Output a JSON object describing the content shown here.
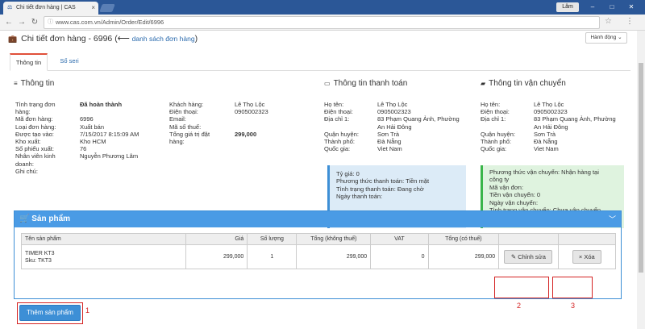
{
  "browser": {
    "tab_title": "Chi tiết đơn hàng | CAS ",
    "tab_close": "×",
    "user": "Lâm",
    "url": "www.cas.com.vn/Admin/Order/Edit/6996",
    "win_min": "–",
    "win_max": "□",
    "win_close": "✕"
  },
  "page": {
    "title": "Chi tiết đơn hàng - 6996",
    "back_arrow": " (⟵ ",
    "back_link": "danh sách đơn hàng",
    "back_close": ")",
    "action_button": "Hành động ⌄",
    "tabs": [
      "Thông tin",
      "Sổ seri"
    ]
  },
  "info": {
    "heading": "Thông tin",
    "col1": [
      {
        "k": "Tình trạng đơn",
        "v": "Đã hoàn thành"
      },
      {
        "k": "hàng:",
        "v": ""
      },
      {
        "k": "Mã đơn hàng:",
        "v": "6996"
      },
      {
        "k": "Loại đơn hàng:",
        "v": "Xuất bán"
      },
      {
        "k": "Được tạo vào:",
        "v": "7/15/2017 8:15:09 AM"
      },
      {
        "k": "Kho xuất:",
        "v": "Kho HCM"
      },
      {
        "k": "Số phiếu xuất:",
        "v": "76"
      },
      {
        "k": "Nhân viên kinh",
        "v": "Nguyễn Phương Lâm"
      },
      {
        "k": "doanh:",
        "v": ""
      },
      {
        "k": "Ghi chú:",
        "v": ""
      }
    ],
    "col2": [
      {
        "k": "Khách hàng:",
        "v": "Lê Thọ Lộc"
      },
      {
        "k": "Điện thoại:",
        "v": "0905002323"
      },
      {
        "k": "Email:",
        "v": ""
      },
      {
        "k": "Mã số thuế:",
        "v": ""
      },
      {
        "k": "Tổng giá trị đặt",
        "v": "299,000"
      },
      {
        "k": "hàng:",
        "v": ""
      }
    ]
  },
  "payment": {
    "heading": "Thông tin thanh toán",
    "rows": [
      {
        "k": "Họ tên:",
        "v": "Lê Thọ Lộc"
      },
      {
        "k": "Điện thoại:",
        "v": "0905002323"
      },
      {
        "k": "Địa chỉ 1:",
        "v": "83 Phạm Quang Ảnh, Phường"
      },
      {
        "k": "",
        "v": "An Hải Đông"
      },
      {
        "k": "Quận huyện:",
        "v": "Sơn Trà"
      },
      {
        "k": "Thành phố:",
        "v": "Đà Nẵng"
      },
      {
        "k": "Quốc gia:",
        "v": "Viet Nam"
      }
    ],
    "box": [
      "Tỷ giá: 0",
      "Phương thức thanh toán: Tiền mặt",
      "Tình trạng thanh toán: Đang chờ",
      "Ngày thanh toán:"
    ]
  },
  "shipping": {
    "heading": "Thông tin vận chuyển",
    "rows": [
      {
        "k": "Họ tên:",
        "v": "Lê Thọ Lộc"
      },
      {
        "k": "Điện thoại:",
        "v": "0905002323"
      },
      {
        "k": "Địa chỉ 1:",
        "v": "83 Phạm Quang Ảnh, Phường"
      },
      {
        "k": "",
        "v": "An Hải Đông"
      },
      {
        "k": "Quận huyện:",
        "v": "Sơn Trà"
      },
      {
        "k": "Thành phố:",
        "v": "Đà Nẵng"
      },
      {
        "k": "Quốc gia:",
        "v": "Viet Nam"
      }
    ],
    "box": [
      "Phương thức vận chuyển: Nhận hàng tại",
      "công ty",
      "Mã vận đơn:",
      "Tiền vận chuyển: 0",
      "Ngày vận chuyển:",
      "Tình trạng vận chuyển: Chưa vận chuyển"
    ]
  },
  "products": {
    "heading": "Sản phẩm",
    "columns": [
      "Tên sản phẩm",
      "Giá",
      "Số lượng",
      "Tổng (không thuế)",
      "VAT",
      "Tổng (có thuế)",
      "",
      ""
    ],
    "row": {
      "name": "TIMER KT3",
      "sku": "Sku: TKT3",
      "price": "299,000",
      "qty": "1",
      "total_no_tax": "299,000",
      "vat": "0",
      "total_tax": "299,000"
    },
    "edit_label": "Chỉnh sửa",
    "delete_label": "Xóa",
    "add_label": "Thêm sản phẩm"
  },
  "annotations": {
    "one": "1",
    "two": "2",
    "three": "3"
  },
  "colors": {
    "accent": "#4a9be5",
    "annotation": "#d42323",
    "tab_active": "#e0503a"
  }
}
